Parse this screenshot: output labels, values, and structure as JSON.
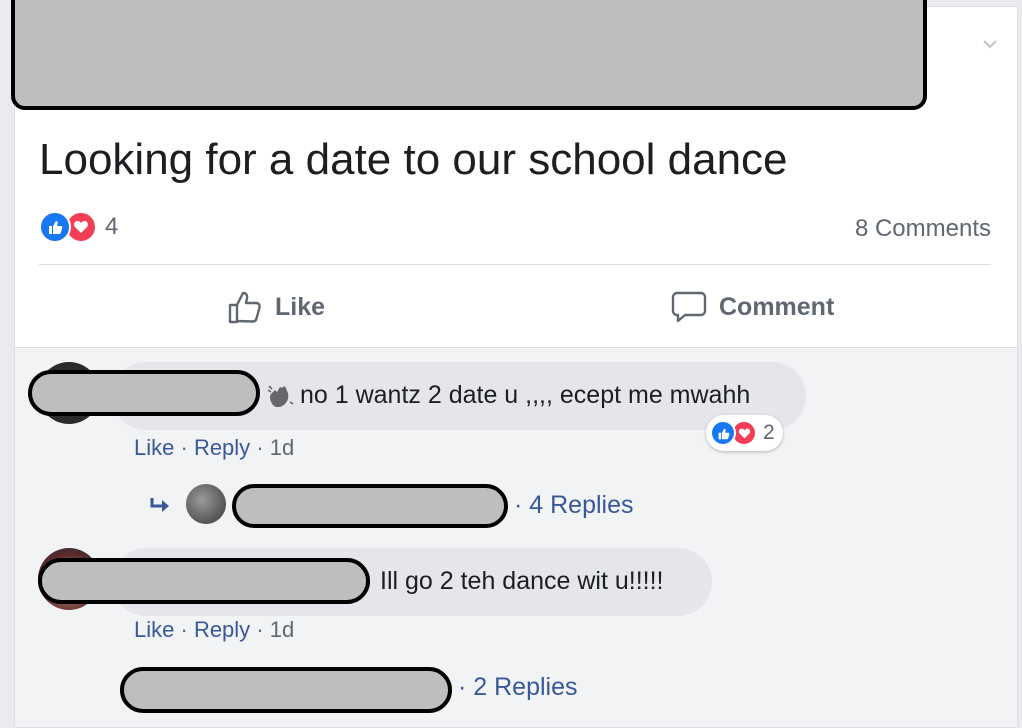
{
  "post": {
    "text": "Looking for a date to our school dance",
    "reaction_count": "4",
    "comments_label": "8 Comments",
    "like_label": "Like",
    "comment_label": "Comment"
  },
  "comments": [
    {
      "emoji_icon": "wave-icon",
      "text": "no 1 wantz 2 date u ,,,, ecept me mwahh",
      "like_label": "Like",
      "reply_label": "Reply",
      "time": "1d",
      "reaction_count": "2",
      "replies_label": "4 Replies"
    },
    {
      "text": "Ill go 2 teh dance wit u!!!!!",
      "like_label": "Like",
      "reply_label": "Reply",
      "time": "1d",
      "replies_label": "2 Replies"
    }
  ],
  "colors": {
    "like_blue": "#1877f2",
    "love_red": "#f33e58",
    "link_blue": "#385898",
    "redaction_gray": "#bebebe"
  }
}
